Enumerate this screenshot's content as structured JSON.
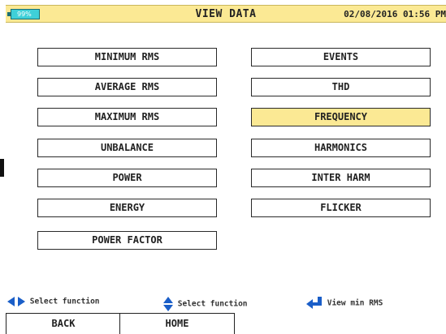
{
  "header": {
    "battery": "99%",
    "title": "VIEW DATA",
    "datetime": "02/08/2016 01:56 PM"
  },
  "functions": {
    "left": [
      "MINIMUM RMS",
      "AVERAGE RMS",
      "MAXIMUM RMS",
      "UNBALANCE",
      "POWER",
      "ENERGY",
      "POWER FACTOR"
    ],
    "right": [
      "EVENTS",
      "THD",
      "FREQUENCY",
      "HARMONICS",
      "INTER HARM",
      "FLICKER"
    ],
    "selected": "FREQUENCY"
  },
  "hints": {
    "lr": "Select function",
    "ud": "Select function",
    "enter": "View min RMS"
  },
  "softkeys": {
    "back": "BACK",
    "home": "HOME"
  },
  "colors": {
    "accent": "#fbe994",
    "battery": "#3fd0d8",
    "arrow": "#1a5ec8"
  }
}
